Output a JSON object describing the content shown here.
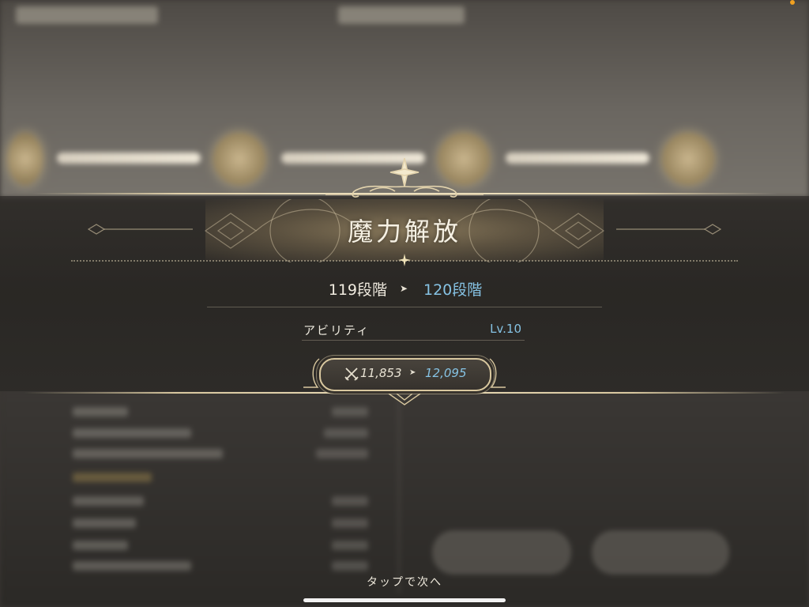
{
  "dialog": {
    "title": "魔力解放",
    "stage": {
      "from": "119段階",
      "to": "120段階"
    },
    "ability": {
      "label": "アビリティ",
      "level": "Lv.10"
    },
    "power": {
      "from": "11,853",
      "to": "12,095",
      "icon": "crossed-swords-icon"
    },
    "arrow_glyph": "➤"
  },
  "footer": {
    "hint": "タップで次へ"
  },
  "colors": {
    "accent_blue": "#86c3e4",
    "gold_trim": "#d9c89f",
    "text_light": "#f1ece0"
  }
}
